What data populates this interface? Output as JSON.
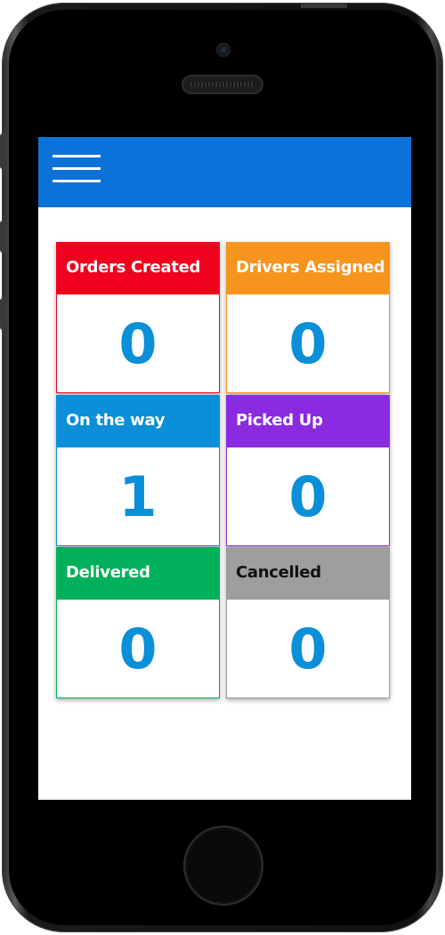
{
  "app": {
    "header_color": "#0a72d8",
    "menu_icon": "hamburger-menu-icon"
  },
  "cards": [
    {
      "label": "Orders Created",
      "count": "0",
      "color": "#f0021e",
      "label_color": "#ffffff"
    },
    {
      "label": "Drivers Assigned",
      "count": "0",
      "color": "#f6941e",
      "label_color": "#ffffff"
    },
    {
      "label": "On the way",
      "count": "1",
      "color": "#0a8fd8",
      "label_color": "#ffffff"
    },
    {
      "label": "Picked Up",
      "count": "0",
      "color": "#8a2be2",
      "label_color": "#ffffff"
    },
    {
      "label": "Delivered",
      "count": "0",
      "color": "#00b05a",
      "label_color": "#ffffff"
    },
    {
      "label": "Cancelled",
      "count": "0",
      "color": "#9e9e9e",
      "label_color": "#111111"
    }
  ],
  "value_color": "#0a8fd8"
}
